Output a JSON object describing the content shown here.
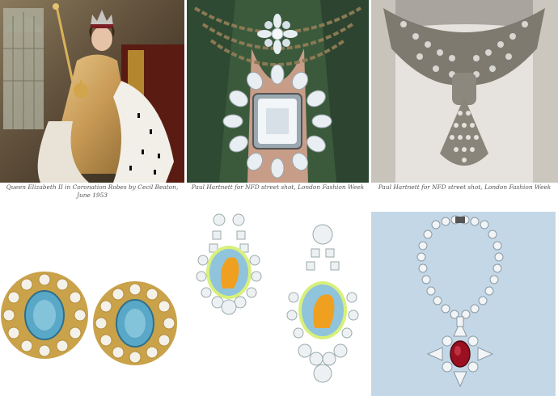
{
  "gallery": {
    "top_row": [
      {
        "name": "queen-portrait",
        "caption_line1": "Queen Elizabeth II in Coronation Robes by Cecil Beaton,",
        "caption_line2": "June 1953"
      },
      {
        "name": "pendant-necklace-closeup",
        "caption_line1": "Paul Hartnett for NFD street shot, London Fashion Week"
      },
      {
        "name": "bib-necklace-closeup",
        "caption_line1": "Paul Hartnett for NFD street shot, London Fashion Week"
      }
    ],
    "bottom_row": [
      {
        "name": "blue-stone-earrings"
      },
      {
        "name": "cameo-drop-earrings"
      },
      {
        "name": "ruby-cross-necklace"
      }
    ]
  },
  "colors": {
    "aquamarine": "#5aa8c8",
    "gold": "#c9a24a",
    "cameo_orange": "#f0a020",
    "cameo_blue": "#8fc4dc",
    "ruby": "#9a1020",
    "powder_blue_bg": "#c4d7e6"
  }
}
